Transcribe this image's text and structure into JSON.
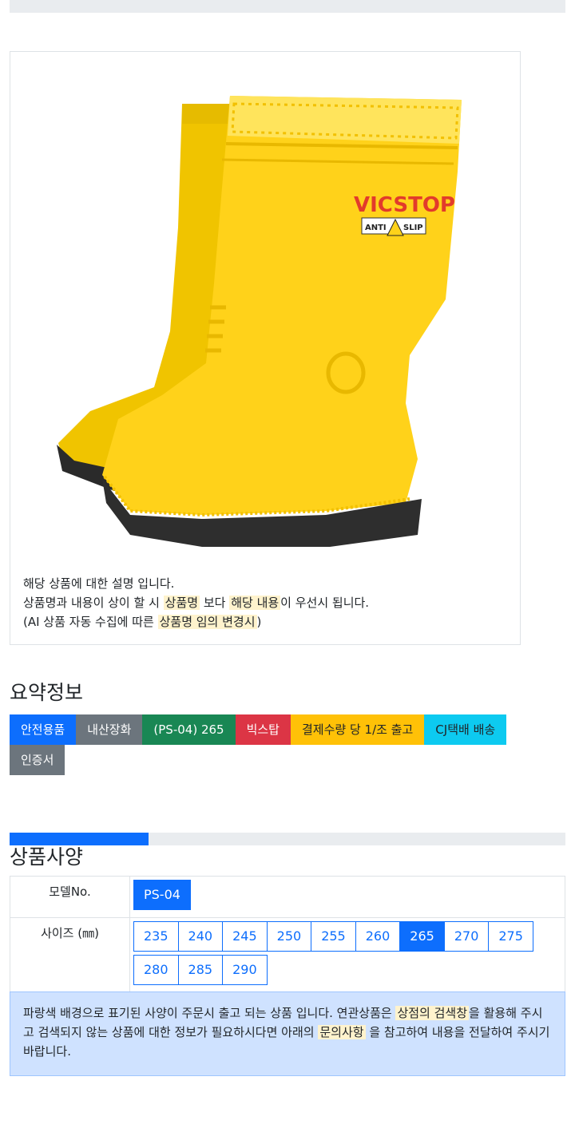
{
  "product": {
    "description_line1": "해당 상품에 대한 설명 입니다.",
    "description_line2_pre": "상품명과 내용이 상이 할 시 ",
    "description_line2_hl1": "상품명",
    "description_line2_mid": " 보다 ",
    "description_line2_hl2": "해당 내용",
    "description_line2_post": "이 우선시 됩니다.",
    "description_line3_pre": "(AI 상품 자동 수집에 따른 ",
    "description_line3_hl": "상품명 임의 변경시",
    "description_line3_post": ")",
    "brand_label": "VICSTOP",
    "brand_sub_left": "ANTI",
    "brand_sub_right": "SLIP"
  },
  "summary": {
    "title": "요약정보",
    "badges": [
      "안전용품",
      "내산장화",
      "(PS-04) 265",
      "빅스탑",
      "결제수량 당 1/조 출고",
      "CJ택배 배송",
      "인증서"
    ]
  },
  "specs": {
    "title": "상품사양",
    "progress": 0.25,
    "model_label": "모델No.",
    "model_value": "PS-04",
    "size_label": "사이즈 (㎜)",
    "sizes": [
      "235",
      "240",
      "245",
      "250",
      "255",
      "260",
      "265",
      "270",
      "275",
      "280",
      "285",
      "290"
    ],
    "selected_size": "265"
  },
  "notice": {
    "part1": "파랑색 배경으로 표기된 사양이 주문시 출고 되는 상품 입니다. 연관상품은 ",
    "hl1": "상점의 검색창",
    "part2": "을 활용해 주시고 검색되지 않는 상품에 대한 정보가 필요하시다면 아래의 ",
    "hl2": "문의사항",
    "part3": " 을 참고하여 내용을 전달하여 주시기 바랍니다."
  },
  "colors": {
    "primary": "#0d6efd",
    "boot_yellow": "#ffd21a",
    "highlight": "#fff3cd",
    "notice_bg": "#cfe2ff"
  }
}
